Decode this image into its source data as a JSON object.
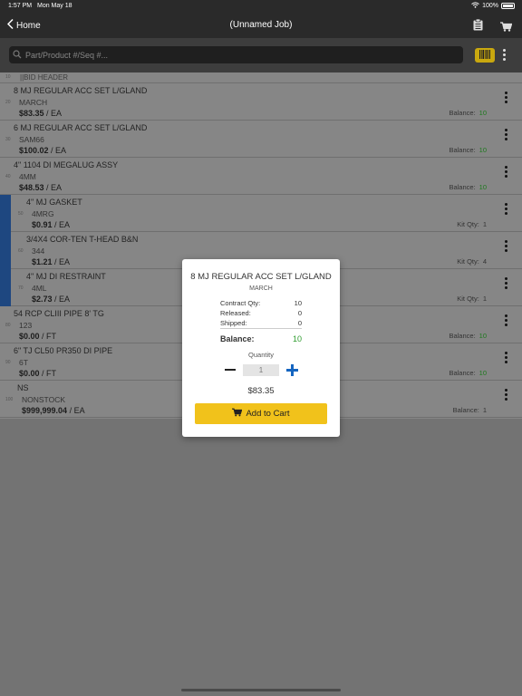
{
  "status_bar": {
    "time": "1:57 PM",
    "date": "Mon May 18",
    "battery": "100%"
  },
  "nav": {
    "back_label": "Home",
    "title": "(Unnamed Job)"
  },
  "search": {
    "placeholder": "Part/Product #/Seq #..."
  },
  "bid_header": {
    "seq": "10",
    "text": "||BID HEADER"
  },
  "rows": [
    {
      "seq": "20",
      "description": "8 MJ REGULAR ACC SET L/GLAND",
      "code": "MARCH",
      "price": "$83.35",
      "unit": " / EA",
      "meta_label": "Balance:",
      "meta_value": "10"
    },
    {
      "seq": "30",
      "description": "6 MJ REGULAR ACC SET L/GLAND",
      "code": "SAM66",
      "price": "$100.02",
      "unit": " / EA",
      "meta_label": "Balance:",
      "meta_value": "10"
    },
    {
      "seq": "40",
      "description": "4\" 1104 DI MEGALUG ASSY",
      "code": "4MM",
      "price": "$48.53",
      "unit": " / EA",
      "meta_label": "Balance:",
      "meta_value": "10"
    },
    {
      "seq": "50",
      "description": "4\" MJ GASKET",
      "code": "4MRG",
      "price": "$0.91",
      "unit": " / EA",
      "meta_label": "Kit Qty:",
      "meta_value": "1"
    },
    {
      "seq": "60",
      "description": "3/4X4 COR-TEN T-HEAD B&N",
      "code": "344",
      "price": "$1.21",
      "unit": " / EA",
      "meta_label": "Kit Qty:",
      "meta_value": "4"
    },
    {
      "seq": "70",
      "description": "4\" MJ DI RESTRAINT",
      "code": "4ML",
      "price": "$2.73",
      "unit": " / EA",
      "meta_label": "Kit Qty:",
      "meta_value": "1"
    },
    {
      "seq": "80",
      "description": "54 RCP CLIII PIPE 8' TG",
      "code": "123",
      "price": "$0.00",
      "unit": " / FT",
      "meta_label": "Balance:",
      "meta_value": "10"
    },
    {
      "seq": "90",
      "description": "6\" TJ CL50 PR350 DI PIPE",
      "code": "6T",
      "price": "$0.00",
      "unit": " / FT",
      "meta_label": "Balance:",
      "meta_value": "10"
    },
    {
      "seq": "100",
      "description": "NS",
      "code": "NONSTOCK",
      "price": "$999,999.04",
      "unit": " / EA",
      "meta_label": "Balance:",
      "meta_value": "1"
    }
  ],
  "popup": {
    "title": "8 MJ REGULAR ACC SET L/GLAND",
    "subtitle": "MARCH",
    "contract_label": "Contract Qty:",
    "contract_value": "10",
    "released_label": "Released:",
    "released_value": "0",
    "shipped_label": "Shipped:",
    "shipped_value": "0",
    "balance_label": "Balance:",
    "balance_value": "10",
    "quantity_label": "Quantity",
    "quantity_value": "1",
    "total": "$83.35",
    "add_button": "Add to Cart"
  },
  "colors": {
    "accent_yellow": "#f1c21b",
    "balance_green": "#2e9c2e",
    "kit_blue": "#1e4780",
    "plus_blue": "#1565c0"
  }
}
